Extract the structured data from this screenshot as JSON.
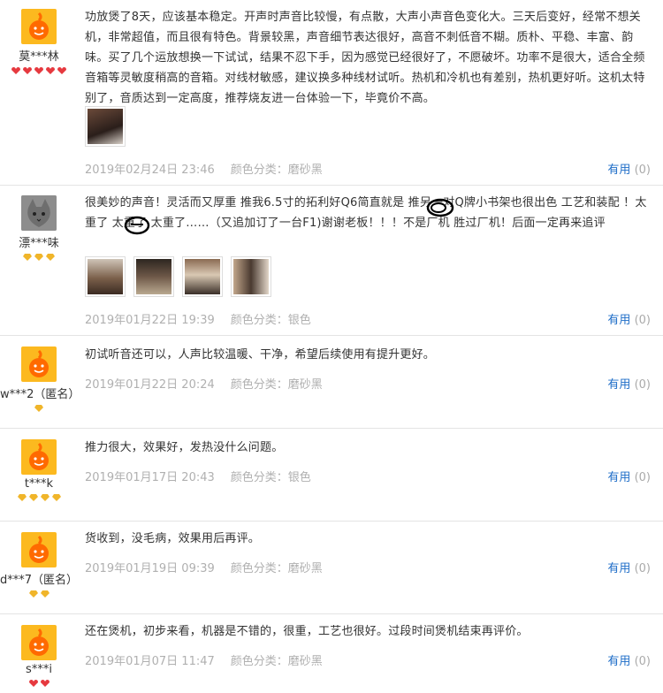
{
  "reviews": [
    {
      "username": "莫***林",
      "avatar": "orange-mascot-avatar",
      "badge_type": "red",
      "badge_count": 5,
      "text": "功放煲了8天，应该基本稳定。开声时声音比较慢，有点散，大声小声音色变化大。三天后变好，经常不想关机，非常超值，而且很有特色。背景较黑，声音细节表达很好，高音不刺低音不糊。质朴、平稳、丰富、韵味。买了几个运放想换一下试试，结果不忍下手，因为感觉已经很好了，不愿破坏。功率不是很大，适合全频音箱等灵敏度稍高的音箱。对线材敏感，建议换多种线材试听。热机和冷机也有差别，热机更好听。这机太特别了，音质达到一定高度，推荐烧友进一台体验一下，毕竟价不高。",
      "images": 1,
      "date": "2019年02月24日 23:46",
      "color_label": "颜色分类：磨砂黑",
      "useful_label": "有用",
      "useful_count": "(0)"
    },
    {
      "username": "漂***味",
      "avatar": "cat-photo-avatar",
      "badge_type": "gold",
      "badge_count": 3,
      "text": "很美妙的声音！灵活而又厚重 推我6.5寸的拓利好Q6简直就是 推另一对Q牌小书架也很出色 工艺和装配 ！太重了 太重了 太重了……（又追加订了一台F1)谢谢老板！！！不是厂机 胜过厂机！后面一定再来追评",
      "images": 4,
      "date": "2019年01月22日 19:39",
      "color_label": "颜色分类：银色",
      "useful_label": "有用",
      "useful_count": "(0)"
    },
    {
      "username": "w***2（匿名）",
      "avatar": "orange-mascot-avatar",
      "badge_type": "gold",
      "badge_count": 1,
      "text": "初试听音还可以，人声比较温暖、干净，希望后续使用有提升更好。",
      "images": 0,
      "date": "2019年01月22日 20:24",
      "color_label": "颜色分类：磨砂黑",
      "useful_label": "有用",
      "useful_count": "(0)"
    },
    {
      "username": "t***k",
      "avatar": "orange-mascot-avatar",
      "badge_type": "gold",
      "badge_count": 4,
      "text": "推力很大，效果好，发热没什么问题。",
      "images": 0,
      "date": "2019年01月17日 20:43",
      "color_label": "颜色分类：银色",
      "useful_label": "有用",
      "useful_count": "(0)"
    },
    {
      "username": "d***7（匿名）",
      "avatar": "orange-mascot-avatar",
      "badge_type": "gold",
      "badge_count": 2,
      "text": "货收到，没毛病，效果用后再评。",
      "images": 0,
      "date": "2019年01月19日 09:39",
      "color_label": "颜色分类：磨砂黑",
      "useful_label": "有用",
      "useful_count": "(0)"
    },
    {
      "username": "s***i",
      "avatar": "orange-mascot-avatar",
      "badge_type": "red",
      "badge_count": 2,
      "text": "还在煲机，初步来看，机器是不错的，很重，工艺也很好。过段时间煲机结束再评价。",
      "images": 0,
      "date": "2019年01月07日 11:47",
      "color_label": "颜色分类：磨砂黑",
      "useful_label": "有用",
      "useful_count": "(0)"
    }
  ]
}
